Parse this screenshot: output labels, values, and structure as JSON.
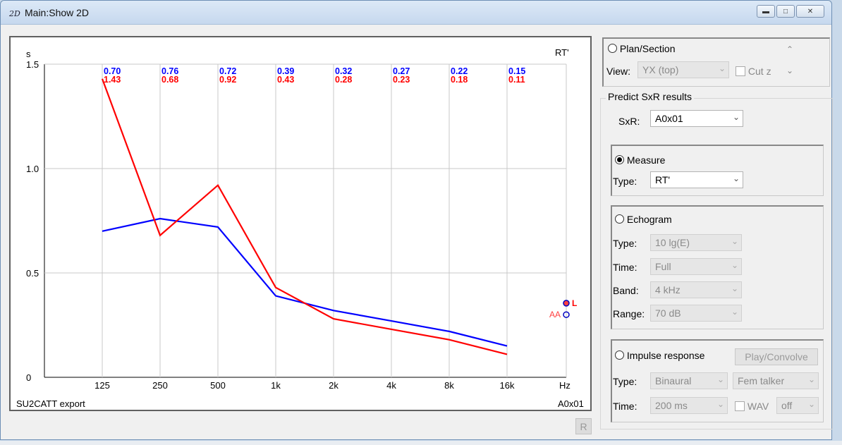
{
  "window": {
    "title": "Main:Show 2D",
    "icon_text": "2D"
  },
  "chart_data": {
    "type": "line",
    "title": "RT'",
    "ylabel": "s",
    "xlabel": "Hz",
    "ylim": [
      0,
      1.5
    ],
    "yticks": [
      "0",
      "0.5",
      "1.0",
      "1.5"
    ],
    "categories": [
      "125",
      "250",
      "500",
      "1k",
      "2k",
      "4k",
      "8k",
      "16k"
    ],
    "series": [
      {
        "color": "#0000ff",
        "values": [
          0.7,
          0.76,
          0.72,
          0.39,
          0.32,
          0.27,
          0.22,
          0.15
        ],
        "labels": [
          "0.70",
          "0.76",
          "0.72",
          "0.39",
          "0.32",
          "0.27",
          "0.22",
          "0.15"
        ]
      },
      {
        "color": "#ff0000",
        "values": [
          1.43,
          0.68,
          0.92,
          0.43,
          0.28,
          0.23,
          0.18,
          0.11
        ],
        "labels": [
          "1.43",
          "0.68",
          "0.92",
          "0.43",
          "0.28",
          "0.23",
          "0.18",
          "0.11"
        ]
      }
    ],
    "footer_left": "SU2CATT export",
    "footer_right": "A0x01",
    "grid": true
  },
  "r_button": "R",
  "plan": {
    "label": "Plan/Section",
    "view_label": "View:",
    "view_value": "YX (top)",
    "cut_label": "Cut z"
  },
  "predict": {
    "label": "Predict SxR results",
    "sxr_label": "SxR:",
    "sxr_value": "A0x01"
  },
  "measure": {
    "label": "Measure",
    "type_label": "Type:",
    "type_value": "RT'"
  },
  "echogram": {
    "label": "Echogram",
    "type_label": "Type:",
    "type_value": "10 lg(E)",
    "time_label": "Time:",
    "time_value": "Full",
    "band_label": "Band:",
    "band_value": "4 kHz",
    "range_label": "Range:",
    "range_value": "70 dB"
  },
  "impulse": {
    "label": "Impulse response",
    "play_label": "Play/Convolve",
    "type_label": "Type:",
    "type_value": "Binaural",
    "talker_value": "Fem talker",
    "time_label": "Time:",
    "time_value": "200 ms",
    "wav_label": "WAV",
    "wav_value": "off"
  },
  "markers": {
    "aa": "AA",
    "l": "L"
  }
}
